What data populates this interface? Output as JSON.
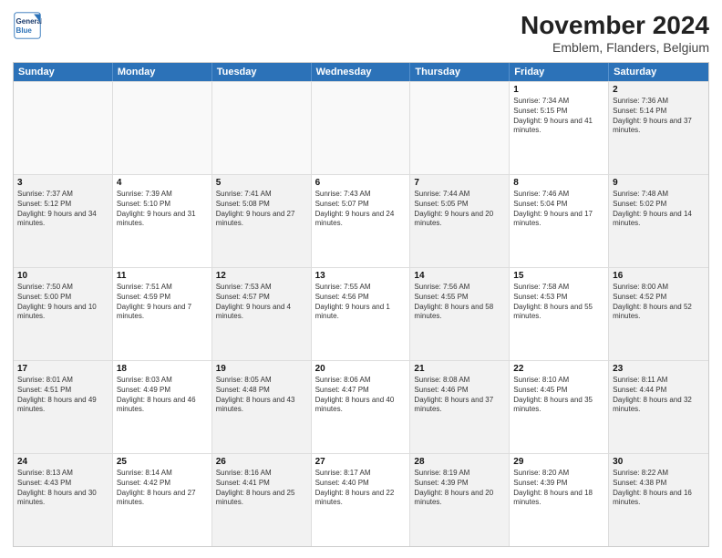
{
  "logo": {
    "line1": "General",
    "line2": "Blue"
  },
  "title": "November 2024",
  "subtitle": "Emblem, Flanders, Belgium",
  "days_of_week": [
    "Sunday",
    "Monday",
    "Tuesday",
    "Wednesday",
    "Thursday",
    "Friday",
    "Saturday"
  ],
  "weeks": [
    [
      {
        "day": "",
        "info": ""
      },
      {
        "day": "",
        "info": ""
      },
      {
        "day": "",
        "info": ""
      },
      {
        "day": "",
        "info": ""
      },
      {
        "day": "",
        "info": ""
      },
      {
        "day": "1",
        "info": "Sunrise: 7:34 AM\nSunset: 5:15 PM\nDaylight: 9 hours and 41 minutes."
      },
      {
        "day": "2",
        "info": "Sunrise: 7:36 AM\nSunset: 5:14 PM\nDaylight: 9 hours and 37 minutes."
      }
    ],
    [
      {
        "day": "3",
        "info": "Sunrise: 7:37 AM\nSunset: 5:12 PM\nDaylight: 9 hours and 34 minutes."
      },
      {
        "day": "4",
        "info": "Sunrise: 7:39 AM\nSunset: 5:10 PM\nDaylight: 9 hours and 31 minutes."
      },
      {
        "day": "5",
        "info": "Sunrise: 7:41 AM\nSunset: 5:08 PM\nDaylight: 9 hours and 27 minutes."
      },
      {
        "day": "6",
        "info": "Sunrise: 7:43 AM\nSunset: 5:07 PM\nDaylight: 9 hours and 24 minutes."
      },
      {
        "day": "7",
        "info": "Sunrise: 7:44 AM\nSunset: 5:05 PM\nDaylight: 9 hours and 20 minutes."
      },
      {
        "day": "8",
        "info": "Sunrise: 7:46 AM\nSunset: 5:04 PM\nDaylight: 9 hours and 17 minutes."
      },
      {
        "day": "9",
        "info": "Sunrise: 7:48 AM\nSunset: 5:02 PM\nDaylight: 9 hours and 14 minutes."
      }
    ],
    [
      {
        "day": "10",
        "info": "Sunrise: 7:50 AM\nSunset: 5:00 PM\nDaylight: 9 hours and 10 minutes."
      },
      {
        "day": "11",
        "info": "Sunrise: 7:51 AM\nSunset: 4:59 PM\nDaylight: 9 hours and 7 minutes."
      },
      {
        "day": "12",
        "info": "Sunrise: 7:53 AM\nSunset: 4:57 PM\nDaylight: 9 hours and 4 minutes."
      },
      {
        "day": "13",
        "info": "Sunrise: 7:55 AM\nSunset: 4:56 PM\nDaylight: 9 hours and 1 minute."
      },
      {
        "day": "14",
        "info": "Sunrise: 7:56 AM\nSunset: 4:55 PM\nDaylight: 8 hours and 58 minutes."
      },
      {
        "day": "15",
        "info": "Sunrise: 7:58 AM\nSunset: 4:53 PM\nDaylight: 8 hours and 55 minutes."
      },
      {
        "day": "16",
        "info": "Sunrise: 8:00 AM\nSunset: 4:52 PM\nDaylight: 8 hours and 52 minutes."
      }
    ],
    [
      {
        "day": "17",
        "info": "Sunrise: 8:01 AM\nSunset: 4:51 PM\nDaylight: 8 hours and 49 minutes."
      },
      {
        "day": "18",
        "info": "Sunrise: 8:03 AM\nSunset: 4:49 PM\nDaylight: 8 hours and 46 minutes."
      },
      {
        "day": "19",
        "info": "Sunrise: 8:05 AM\nSunset: 4:48 PM\nDaylight: 8 hours and 43 minutes."
      },
      {
        "day": "20",
        "info": "Sunrise: 8:06 AM\nSunset: 4:47 PM\nDaylight: 8 hours and 40 minutes."
      },
      {
        "day": "21",
        "info": "Sunrise: 8:08 AM\nSunset: 4:46 PM\nDaylight: 8 hours and 37 minutes."
      },
      {
        "day": "22",
        "info": "Sunrise: 8:10 AM\nSunset: 4:45 PM\nDaylight: 8 hours and 35 minutes."
      },
      {
        "day": "23",
        "info": "Sunrise: 8:11 AM\nSunset: 4:44 PM\nDaylight: 8 hours and 32 minutes."
      }
    ],
    [
      {
        "day": "24",
        "info": "Sunrise: 8:13 AM\nSunset: 4:43 PM\nDaylight: 8 hours and 30 minutes."
      },
      {
        "day": "25",
        "info": "Sunrise: 8:14 AM\nSunset: 4:42 PM\nDaylight: 8 hours and 27 minutes."
      },
      {
        "day": "26",
        "info": "Sunrise: 8:16 AM\nSunset: 4:41 PM\nDaylight: 8 hours and 25 minutes."
      },
      {
        "day": "27",
        "info": "Sunrise: 8:17 AM\nSunset: 4:40 PM\nDaylight: 8 hours and 22 minutes."
      },
      {
        "day": "28",
        "info": "Sunrise: 8:19 AM\nSunset: 4:39 PM\nDaylight: 8 hours and 20 minutes."
      },
      {
        "day": "29",
        "info": "Sunrise: 8:20 AM\nSunset: 4:39 PM\nDaylight: 8 hours and 18 minutes."
      },
      {
        "day": "30",
        "info": "Sunrise: 8:22 AM\nSunset: 4:38 PM\nDaylight: 8 hours and 16 minutes."
      }
    ]
  ]
}
